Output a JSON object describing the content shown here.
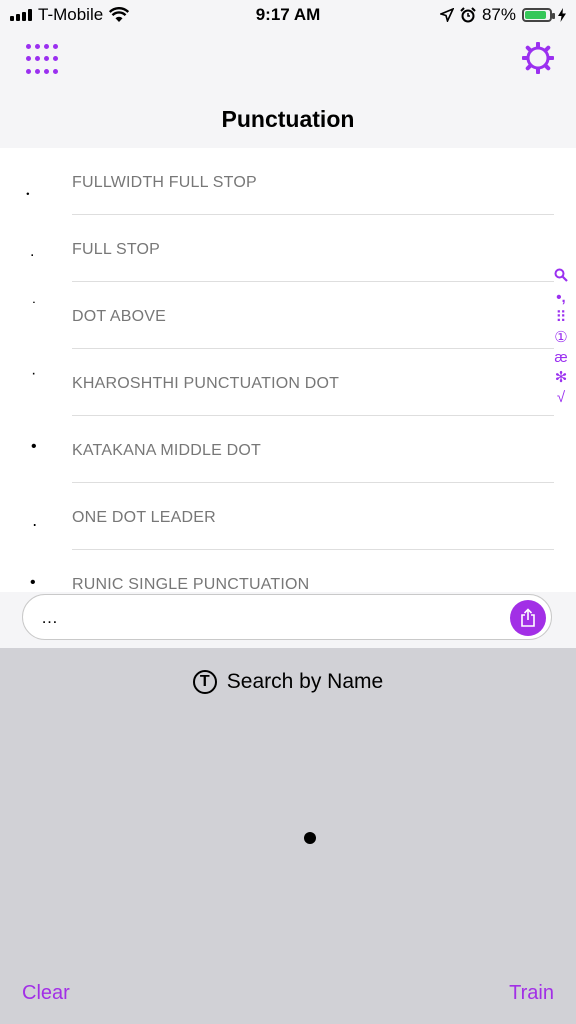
{
  "status_bar": {
    "carrier": "T-Mobile",
    "time": "9:17 AM",
    "battery_percent": "87%",
    "battery_level": 0.87,
    "icons": [
      "signal-icon",
      "wifi-icon",
      "location-icon",
      "alarm-icon",
      "battery-icon"
    ]
  },
  "header": {
    "title": "Punctuation",
    "left_icon": "grid-icon",
    "right_icon": "gear-icon"
  },
  "list": {
    "items": [
      {
        "glyph": "．",
        "name": "FULLWIDTH FULL STOP"
      },
      {
        "glyph": ".",
        "name": "FULL STOP"
      },
      {
        "glyph": "˙",
        "name": "DOT ABOVE"
      },
      {
        "glyph": "·",
        "name": "KHAROSHTHI PUNCTUATION DOT"
      },
      {
        "glyph": "•",
        "name": "KATAKANA MIDDLE DOT"
      },
      {
        "glyph": "․",
        "name": "ONE DOT LEADER"
      },
      {
        "glyph": "•",
        "name": "RUNIC SINGLE PUNCTUATION"
      }
    ]
  },
  "index": [
    "🔍",
    "•,",
    "⠿",
    "①",
    "æ",
    "✻",
    "√"
  ],
  "input": {
    "value": "…"
  },
  "canvas": {
    "search_label": "Search by Name",
    "clear_label": "Clear",
    "train_label": "Train"
  },
  "colors": {
    "accent": "#a22fe6",
    "canvas_bg": "#d1d1d6",
    "battery_green": "#35c759"
  }
}
